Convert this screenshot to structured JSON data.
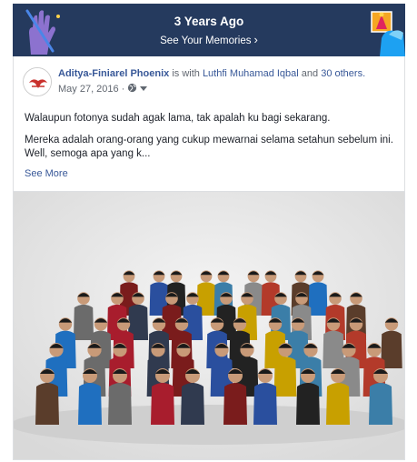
{
  "banner": {
    "title": "3 Years Ago",
    "link_label": "See Your Memories",
    "chevron": "›",
    "bg_color": "#253a5e",
    "left_art_icon": "party-hand-icon",
    "right_art_icon": "party-hat-icon"
  },
  "post": {
    "author": "Aditya-Finiarel Phoenix",
    "with_text": "is with",
    "tagged": "Luthfi Muhamad Iqbal",
    "and_text": "and",
    "others": "30 others.",
    "date": "May 27, 2016",
    "separator": "·",
    "privacy_icon": "globe-icon",
    "paragraph1": "Walaupun fotonya sudah agak lama, tak apalah ku bagi sekarang.",
    "paragraph2": "Mereka adalah orang-orang yang cukup mewarnai selama setahun sebelum ini. Well, semoga apa yang k...",
    "see_more": "See More",
    "link_color": "#385898"
  },
  "photo": {
    "subject": "group-photo"
  }
}
